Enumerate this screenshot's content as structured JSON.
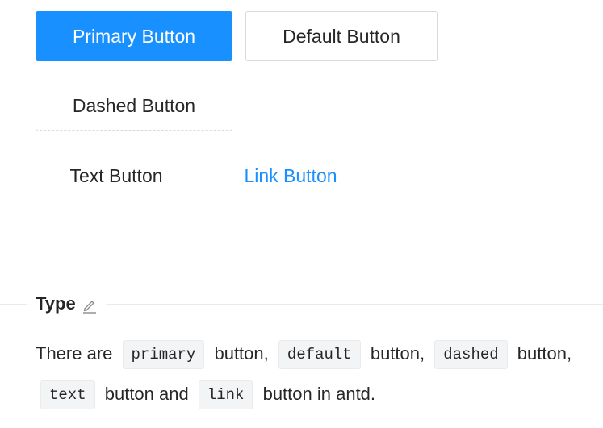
{
  "buttons": {
    "primary": "Primary Button",
    "default": "Default Button",
    "dashed": "Dashed Button",
    "text": "Text Button",
    "link": "Link Button"
  },
  "section": {
    "title": "Type",
    "edit_icon": "edit-pencil-icon"
  },
  "description": {
    "p1": "There are",
    "code1": "primary",
    "p2": "button,",
    "code2": "default",
    "p3": "button,",
    "code3": "dashed",
    "p4": "button,",
    "code4": "text",
    "p5": "button and",
    "code5": "link",
    "p6": "button in antd."
  },
  "colors": {
    "primary": "#1890ff",
    "border": "#d9d9d9",
    "code_bg": "#f2f4f5"
  }
}
